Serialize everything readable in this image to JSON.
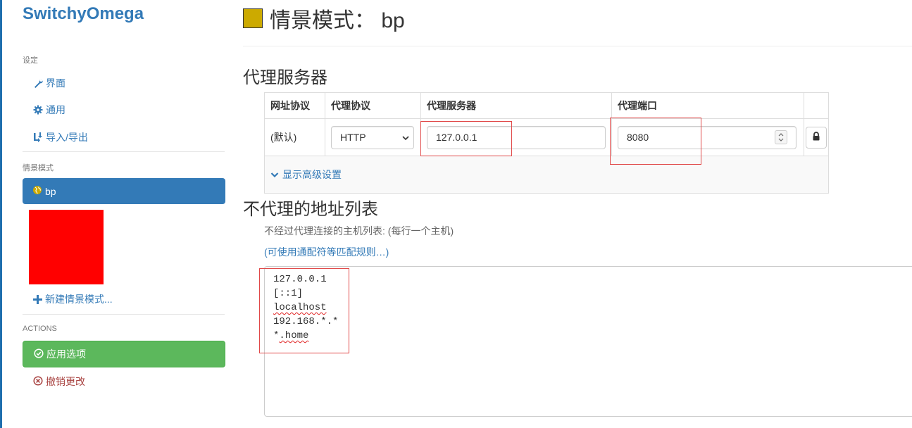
{
  "sidebar": {
    "brand": "SwitchyOmega",
    "settings_header": "设定",
    "items": [
      {
        "label": "界面",
        "icon": "wrench-icon"
      },
      {
        "label": "通用",
        "icon": "gear-icon"
      },
      {
        "label": "导入/导出",
        "icon": "import-export-icon"
      }
    ],
    "profiles_header": "情景模式",
    "active_profile": {
      "label": "bp",
      "icon": "globe-icon"
    },
    "new_profile": "新建情景模式...",
    "actions_header": "ACTIONS",
    "apply": "应用选项",
    "discard": "撤销更改"
  },
  "main": {
    "title": "情景模式： bp",
    "profile_color": "#ccaa00",
    "proxy_section_title": "代理服务器",
    "table_headers": [
      "网址协议",
      "代理协议",
      "代理服务器",
      "代理端口"
    ],
    "row": {
      "scheme": "(默认)",
      "protocol": "HTTP",
      "server": "127.0.0.1",
      "port": "8080"
    },
    "advanced_link": "显示高级设置",
    "bypass_section_title": "不代理的地址列表",
    "bypass_help": "不经过代理连接的主机列表: (每行一个主机)",
    "wildcard_link": "(可使用通配符等匹配规则…)",
    "bypass_list": [
      "127.0.0.1",
      "[::1]",
      "localhost",
      "192.168.*.*",
      "*.home"
    ]
  },
  "colors": {
    "accent": "#337ab7",
    "apply_green": "#5cb85c",
    "discard_red": "#a94442",
    "highlight_red": "#e04848"
  }
}
